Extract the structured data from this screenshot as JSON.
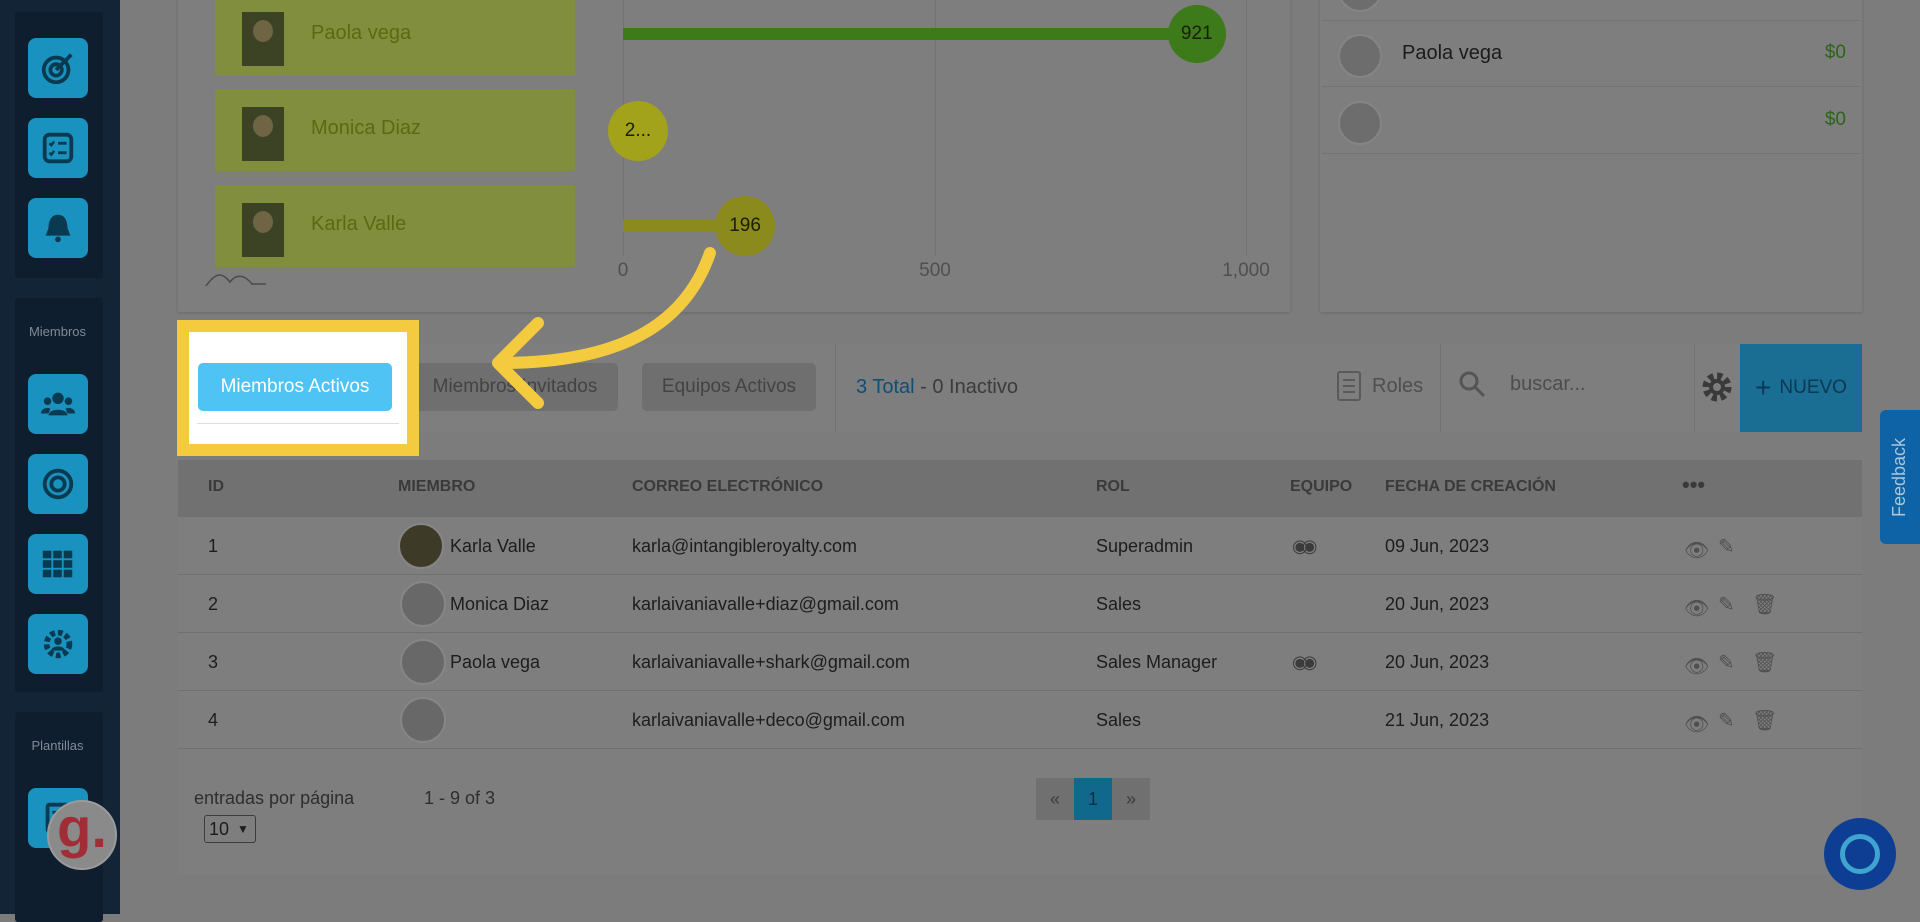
{
  "sidebar": {
    "section_members": "Miembros",
    "section_templates": "Plantillas",
    "icons": [
      "target-icon",
      "checklist-icon",
      "bell-icon",
      "users-icon",
      "circle-target-icon",
      "grid-icon",
      "gear-users-icon",
      "template-icon"
    ],
    "badge_letter": "g."
  },
  "chart": {
    "rows": [
      {
        "name": "Paola vega",
        "value": 921,
        "label": "921"
      },
      {
        "name": "Monica Diaz",
        "value": 0,
        "label": "2..."
      },
      {
        "name": "Karla Valle",
        "value": 196,
        "label": "196"
      }
    ],
    "ticks": [
      "0",
      "500",
      "1,000"
    ],
    "colors": {
      "bar_high": "#3c7a1a",
      "bar_low": "#8a8a1d",
      "bubble_mid": "#a2a21b"
    }
  },
  "right_list": [
    {
      "name": "Paola vega",
      "amount": "$0"
    },
    {
      "name": "",
      "amount": "$0"
    }
  ],
  "toolbar": {
    "tab_active": "Miembros Activos",
    "tab_invited": "Miembros Invitados",
    "tab_teams": "Equipos Activos",
    "total_label": "3 Total",
    "total_separator": " - ",
    "inactive_label": "0 Inactivo",
    "roles_label": "Roles",
    "search_placeholder": "buscar...",
    "new_label": "NUEVO",
    "accent": "#4fc3f3",
    "highlight": "#f4ca3e"
  },
  "table": {
    "headers": {
      "id": "ID",
      "member": "MIEMBRO",
      "email": "CORREO ELECTRÓNICO",
      "role": "ROL",
      "team": "EQUIPO",
      "created": "FECHA DE CREACIÓN",
      "more": "•••"
    },
    "rows": [
      {
        "id": "1",
        "member": "Karla Valle",
        "email": "karla@intangibleroyalty.com",
        "role": "Superadmin",
        "created": "09 Jun, 2023"
      },
      {
        "id": "2",
        "member": "Monica Diaz",
        "email": "karlaivaniavalle+diaz@gmail.com",
        "role": "Sales",
        "created": "20 Jun, 2023"
      },
      {
        "id": "3",
        "member": "Paola vega",
        "email": "karlaivaniavalle+shark@gmail.com",
        "role": "Sales Manager",
        "created": "20 Jun, 2023"
      },
      {
        "id": "4",
        "member": "",
        "email": "karlaivaniavalle+deco@gmail.com",
        "role": "Sales",
        "created": "21 Jun, 2023"
      }
    ]
  },
  "pagination": {
    "entries_label": "entradas por página",
    "page_size": "10",
    "range": "1 - 9 of 3",
    "prev": "«",
    "current": "1",
    "next": "»"
  },
  "feedback_label": "Feedback"
}
